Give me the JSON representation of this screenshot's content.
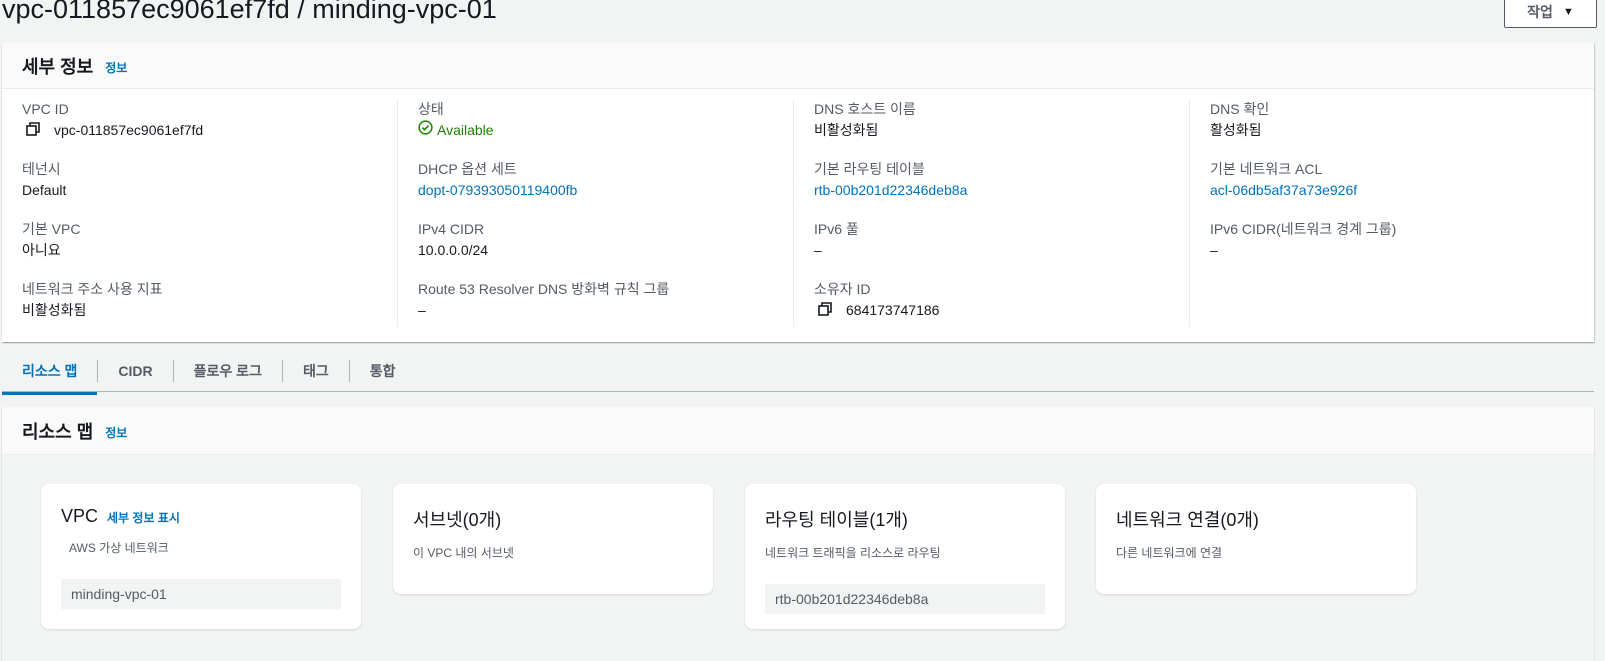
{
  "header": {
    "title": "vpc-011857ec9061ef7fd / minding-vpc-01",
    "actions_label": "작업"
  },
  "details": {
    "heading": "세부 정보",
    "info_label": "정보",
    "columns": [
      [
        {
          "label": "VPC ID",
          "value": "vpc-011857ec9061ef7fd"
        },
        {
          "label": "테넌시",
          "value": "Default"
        },
        {
          "label": "기본 VPC",
          "value": "아니요"
        },
        {
          "label": "네트워크 주소 사용 지표",
          "value": "비활성화됨"
        }
      ],
      [
        {
          "label": "상태",
          "value": "Available"
        },
        {
          "label": "DHCP 옵션 세트",
          "value": "dopt-079393050119400fb"
        },
        {
          "label": "IPv4 CIDR",
          "value": "10.0.0.0/24"
        },
        {
          "label": "Route 53 Resolver DNS 방화벽 규칙 그룹",
          "value": "–"
        }
      ],
      [
        {
          "label": "DNS 호스트 이름",
          "value": "비활성화됨"
        },
        {
          "label": "기본 라우팅 테이블",
          "value": "rtb-00b201d22346deb8a"
        },
        {
          "label": "IPv6 풀",
          "value": "–"
        },
        {
          "label": "소유자 ID",
          "value": "684173747186"
        }
      ],
      [
        {
          "label": "DNS 확인",
          "value": "활성화됨"
        },
        {
          "label": "기본 네트워크 ACL",
          "value": "acl-06db5af37a73e926f"
        },
        {
          "label": "IPv6 CIDR(네트워크 경계 그룹)",
          "value": "–"
        }
      ]
    ]
  },
  "tabs": [
    "리소스 맵",
    "CIDR",
    "플로우 로그",
    "태그",
    "통합"
  ],
  "resource_map": {
    "heading": "리소스 맵",
    "info_label": "정보",
    "cards": [
      {
        "title": "VPC",
        "detail_link": "세부 정보 표시",
        "subtitle": "AWS 가상 네트워크",
        "chip": "minding-vpc-01"
      },
      {
        "title": "서브넷(0개)",
        "subtitle": "이 VPC 내의 서브넷"
      },
      {
        "title": "라우팅 테이블(1개)",
        "subtitle": "네트워크 트래픽을 리소스로 라우팅",
        "chip": "rtb-00b201d22346deb8a"
      },
      {
        "title": "네트워크 연결(0개)",
        "subtitle": "다른 네트워크에 연결"
      }
    ]
  },
  "colors": {
    "link": "#0073bb",
    "success": "#1d8102",
    "text": "#16191f",
    "muted": "#545b64"
  }
}
